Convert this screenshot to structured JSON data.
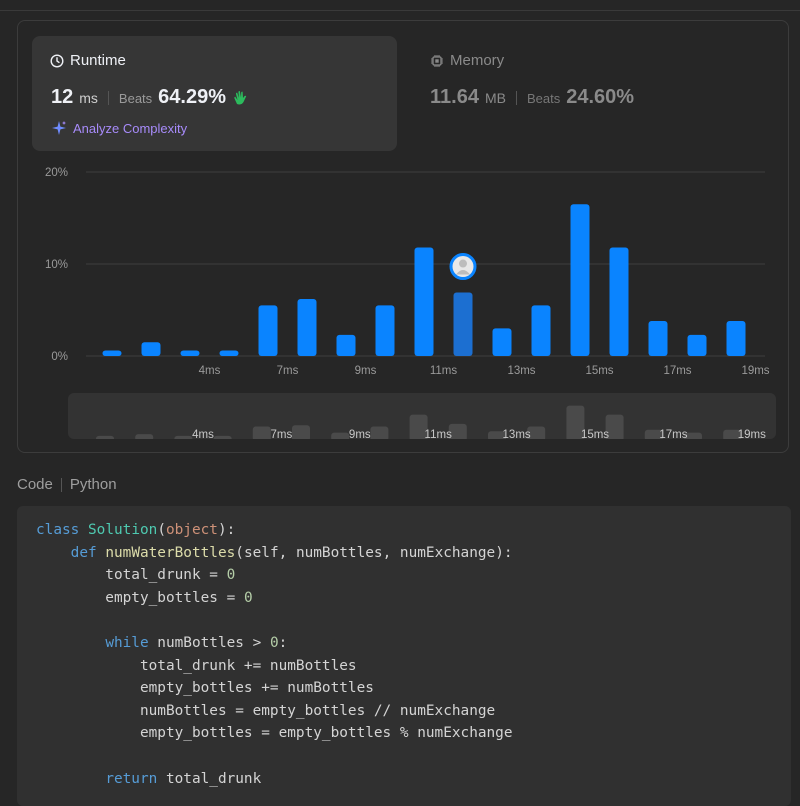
{
  "runtime": {
    "title": "Runtime",
    "value": "12",
    "unit": "ms",
    "beats_label": "Beats",
    "beats_value": "64.29%"
  },
  "memory": {
    "title": "Memory",
    "value": "11.64",
    "unit": "MB",
    "beats_label": "Beats",
    "beats_value": "24.60%"
  },
  "analyze_label": "Analyze Complexity",
  "colors": {
    "bar": "#0a84ff",
    "bar_selected": "#1c6fd1",
    "mini_bar": "#4a4a4a",
    "analyze": "#a78bfa",
    "beats_icon": "#2cbb5d"
  },
  "chart_data": {
    "type": "bar",
    "y_ticks": [
      "20%",
      "10%",
      "0%"
    ],
    "ylim": [
      0,
      20
    ],
    "x_labels": [
      "4ms",
      "7ms",
      "9ms",
      "11ms",
      "13ms",
      "15ms",
      "17ms",
      "19ms"
    ],
    "x_label_positions": [
      3,
      5,
      7,
      9,
      11,
      13,
      15,
      17
    ],
    "values": [
      0.6,
      1.5,
      0.6,
      0.6,
      5.5,
      6.2,
      2.3,
      5.5,
      11.8,
      6.9,
      3.0,
      5.5,
      16.5,
      11.8,
      3.8,
      2.3,
      3.8
    ],
    "highlight_index": 9,
    "grid": true
  },
  "code": {
    "label": "Code",
    "language": "Python"
  }
}
